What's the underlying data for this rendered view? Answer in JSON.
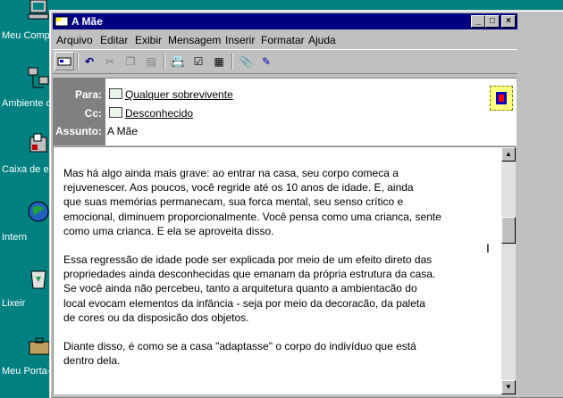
{
  "desktop": {
    "icons": [
      {
        "label": "Meu Comp",
        "icon": "computer-icon"
      },
      {
        "label": "Ambiente c",
        "icon": "network-icon"
      },
      {
        "label": "Caixa de e",
        "icon": "inbox-icon"
      },
      {
        "label": "Intern",
        "icon": "internet-icon"
      },
      {
        "label": "Lixeir",
        "icon": "recycle-bin-icon"
      },
      {
        "label": "Meu Porta-",
        "icon": "briefcase-icon"
      }
    ]
  },
  "window": {
    "title": "A Mãe",
    "controls": {
      "minimize": "_",
      "maximize": "□",
      "close": "×"
    }
  },
  "menu": [
    "Arquivo",
    "Editar",
    "Exibir",
    "Mensagem",
    "Inserir",
    "Formatar",
    "Ajuda"
  ],
  "toolbar": [
    "send-icon",
    "undo-icon",
    "cut-icon",
    "copy-icon",
    "paste-icon",
    "address-book-icon",
    "check-names-icon",
    "select-recipients-icon",
    "attach-icon",
    "signature-icon"
  ],
  "header": {
    "to_label": "Para:",
    "to_value": "Qualquer sobrevivente",
    "cc_label": "Cc:",
    "cc_value": "Desconhecido",
    "subject_label": "Assunto:",
    "subject_value": "A Mãe"
  },
  "body": {
    "paragraphs": [
      "Mas há algo ainda mais grave: ao entrar na casa, seu corpo comeca a\nrejuvenescer. Aos poucos, você regride até os 10 anos de idade. E, ainda\nque suas memórias permanecam, sua forca mental, seu senso crítico e\nemocional, diminuem proporcionalmente. Você pensa como uma crianca, sente\ncomo uma crianca. E ela se aproveita disso.",
      "Essa regressão de idade pode ser explicada por meio de um efeito direto das\npropriedades ainda desconhecidas que emanam da própria estrutura da casa.\nSe você ainda não percebeu, tanto a arquitetura quanto a ambientacão do\nlocal evocam elementos da infância - seja por meio da decoracão, da paleta\nde cores ou da disposicão dos objetos.",
      "Diante disso, é como se a casa \"adaptasse\" o corpo do indivíduo que está\ndentro dela."
    ]
  }
}
